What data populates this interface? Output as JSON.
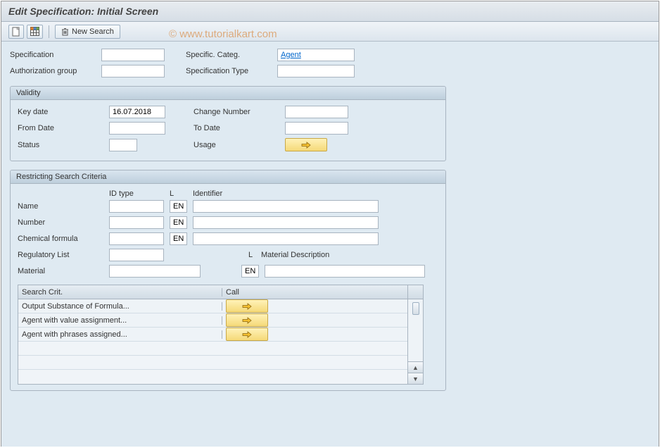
{
  "title": "Edit Specification: Initial Screen",
  "watermark": "© www.tutorialkart.com",
  "toolbar": {
    "new_search_label": "New Search"
  },
  "topFields": {
    "specification_label": "Specification",
    "specification_value": "",
    "specific_categ_label": "Specific. Categ.",
    "specific_categ_value": "Agent",
    "auth_group_label": "Authorization group",
    "auth_group_value": "",
    "spec_type_label": "Specification Type",
    "spec_type_value": ""
  },
  "validity": {
    "header": "Validity",
    "key_date_label": "Key date",
    "key_date_value": "16.07.2018",
    "change_number_label": "Change Number",
    "change_number_value": "",
    "from_date_label": "From Date",
    "from_date_value": "",
    "to_date_label": "To Date",
    "to_date_value": "",
    "status_label": "Status",
    "status_value": "",
    "usage_label": "Usage"
  },
  "restrict": {
    "header": "Restricting Search Criteria",
    "col_idtype": "ID type",
    "col_l": "L",
    "col_identifier": "Identifier",
    "name_label": "Name",
    "name_lang": "EN",
    "number_label": "Number",
    "number_lang": "EN",
    "chem_label": "Chemical formula",
    "chem_lang": "EN",
    "reg_label": "Regulatory List",
    "mat_label": "Material",
    "mat_lang": "EN",
    "matdesc_l": "L",
    "matdesc_label": "Material Description"
  },
  "searchCrit": {
    "col1": "Search Crit.",
    "col2": "Call",
    "rows": [
      "Output Substance of Formula...",
      "Agent with value assignment...",
      "Agent with phrases assigned..."
    ]
  }
}
